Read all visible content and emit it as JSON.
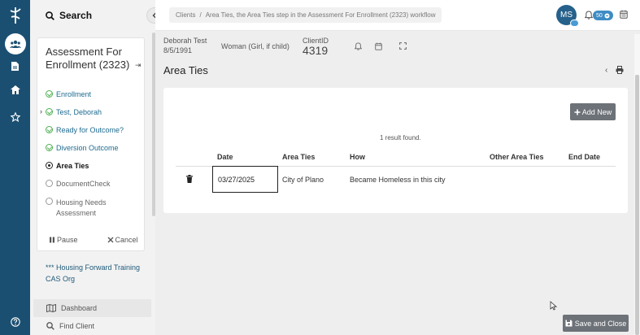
{
  "rail": {
    "icons": [
      "logo-icon",
      "users-icon",
      "document-icon",
      "home-icon",
      "star-icon",
      "help-icon"
    ]
  },
  "sidebar": {
    "search_label": "Search",
    "workflow_title": "Assessment For Enrollment (2323)",
    "steps": [
      {
        "label": "Enrollment",
        "status": "done"
      },
      {
        "label": "Test, Deborah",
        "status": "done"
      },
      {
        "label": "Ready for Outcome?",
        "status": "done"
      },
      {
        "label": "Diversion Outcome",
        "status": "done"
      },
      {
        "label": "Area Ties",
        "status": "current"
      },
      {
        "label": "DocumentCheck",
        "status": "pending"
      },
      {
        "label": "Housing Needs Assessment",
        "status": "pending"
      }
    ],
    "pause_label": "Pause",
    "cancel_label": "Cancel",
    "org": "*** Housing Forward Training CAS Org",
    "nav_dashboard": "Dashboard",
    "nav_find_client": "Find Client"
  },
  "topbar": {
    "crumb_root": "Clients",
    "crumb_sep": "/",
    "crumb_current": "Area Ties, the Area Ties step in the Assessment For Enrollment (2323) workflow",
    "avatar_initials": "MS",
    "notification_count": "50"
  },
  "client": {
    "name": "Deborah Test",
    "dob": "8/5/1991",
    "gender": "Woman (Girl, if child)",
    "id_label": "ClientID",
    "id_value": "4319"
  },
  "page": {
    "title": "Area Ties"
  },
  "table": {
    "add_label": "Add New",
    "found_text": "1 result found.",
    "headers": [
      "Date",
      "Area Ties",
      "How",
      "Other Area Ties",
      "End Date"
    ],
    "rows": [
      {
        "date": "03/27/2025",
        "area_ties": "City of Plano",
        "how": "Became Homeless in this city",
        "other": "",
        "end_date": ""
      }
    ]
  },
  "footer": {
    "save_close_label": "Save and Close"
  },
  "colors": {
    "rail": "#1b4f72",
    "accent": "#25618a",
    "done": "#4caf50",
    "button": "#6d7278"
  }
}
